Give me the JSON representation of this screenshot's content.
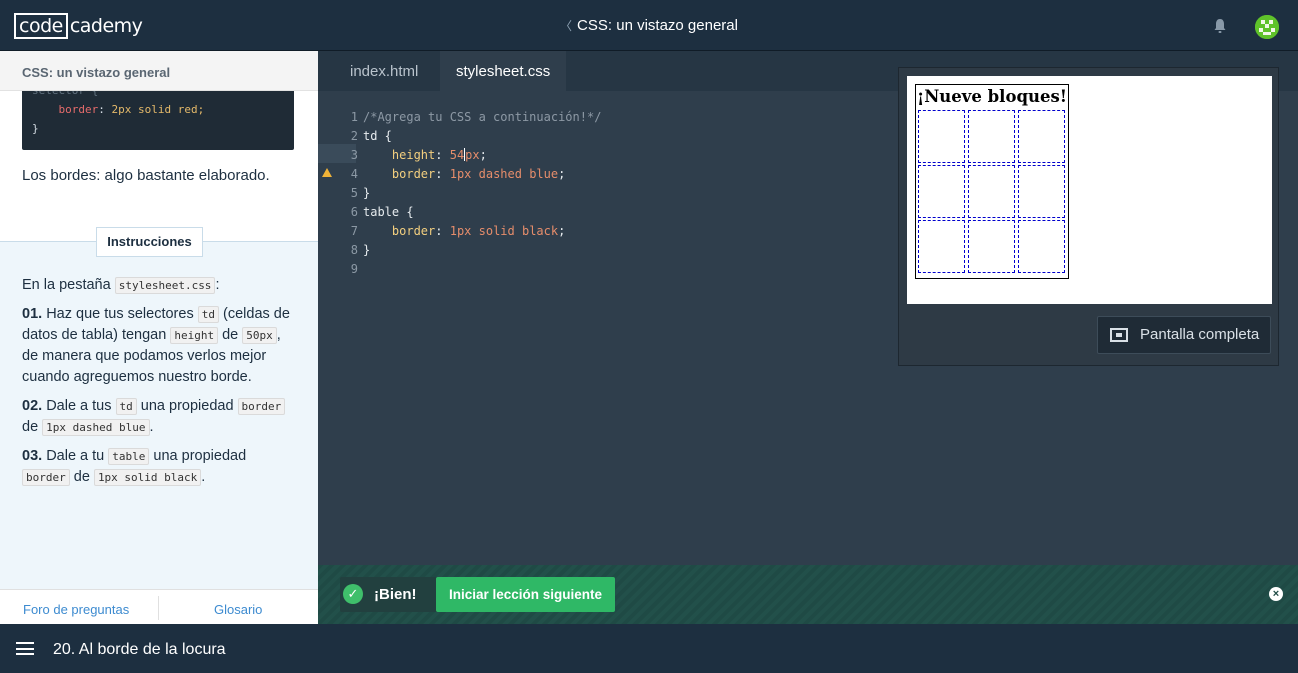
{
  "topbar": {
    "logo_box": "code",
    "logo_rest": "cademy",
    "title": "CSS: un vistazo general",
    "chevron": "〈",
    "icons": {
      "bell": "bell-icon",
      "avatar": "avatar-icon"
    },
    "avatar_color": "#5fc22a"
  },
  "left": {
    "header": "CSS: un vistazo general",
    "snippet": {
      "line1": "selector {",
      "line2_prop": "border",
      "line2_val": "2px solid red;",
      "line3": "}"
    },
    "borde_text": "Los bordes: algo bastante elaborado.",
    "instr_tab": "Instrucciones",
    "intro_prefix": "En la pestaña ",
    "intro_code": "stylesheet.css",
    "intro_suffix": ":",
    "steps": [
      {
        "num": "01.",
        "t1": " Haz que tus selectores ",
        "c1": "td",
        "t2": " (celdas de datos de tabla) tengan ",
        "c2": "height",
        "t3": " de ",
        "c3": "50px",
        "t4": ", de manera que podamos verlos mejor cuando agreguemos nuestro borde."
      },
      {
        "num": "02.",
        "t1": " Dale a tus ",
        "c1": "td",
        "t2": " una propiedad ",
        "c2": "border",
        "t3": " de ",
        "c3": "1px dashed blue",
        "t4": "."
      },
      {
        "num": "03.",
        "t1": " Dale a tu ",
        "c1": "table",
        "t2": " una propiedad ",
        "c2": "border",
        "t3": " de ",
        "c3": "1px solid black",
        "t4": "."
      }
    ],
    "footer": {
      "forum": "Foro de preguntas",
      "glossary": "Glosario"
    }
  },
  "editor": {
    "tabs": [
      "index.html",
      "stylesheet.css"
    ],
    "active_tab": "stylesheet.css",
    "line_numbers": [
      "1",
      "2",
      "3",
      "4",
      "5",
      "6",
      "7",
      "8",
      "9"
    ],
    "lines": {
      "l1": "/*Agrega tu CSS a continuación!*/",
      "l2": "td {",
      "l3_prop": "height",
      "l3_num_a": "54",
      "l3_num_b": "px",
      "l4_prop": "border",
      "l4_val": "1px dashed blue",
      "l5": "}",
      "l6": "table {",
      "l7_prop": "border",
      "l7_val": "1px solid black",
      "l8": "}"
    },
    "warning_icon": "warning-icon"
  },
  "preview": {
    "caption": "¡Nueve bloques!",
    "fullscreen_label": "Pantalla completa",
    "cells": 9
  },
  "success": {
    "label": "¡Bien!",
    "next_label": "Iniciar lección siguiente",
    "check_icon": "check-icon",
    "close_icon": "close-icon"
  },
  "bottombar": {
    "lesson": "20. Al borde de la locura",
    "menu_icon": "hamburger-icon"
  }
}
